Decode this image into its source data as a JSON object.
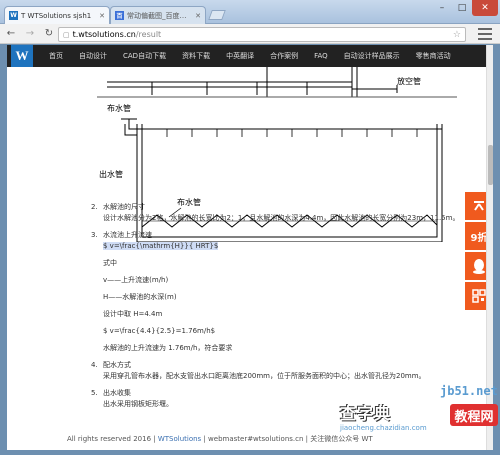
{
  "browser": {
    "tabs": [
      {
        "title": "T WTSolutions sjsh1",
        "favicon": "W",
        "favicon_color": "#1e73be",
        "active": true
      },
      {
        "title": "常动偏截图_百度经验",
        "favicon": "百",
        "favicon_color": "#3a6fd8",
        "active": false
      }
    ],
    "url_host": "t.wtsolutions.cn",
    "url_path": "/result"
  },
  "site": {
    "logo": "W",
    "nav": [
      "首页",
      "自动设计",
      "CAD自动下载",
      "资料下载",
      "中英翻译",
      "合作案例",
      "FAQ",
      "自动设计样品展示",
      "零售商活动"
    ]
  },
  "drawing": {
    "label_distributor_top": "布水管",
    "label_vent": "放空管",
    "label_outlet": "出水管",
    "label_distributor": "布水管"
  },
  "content": {
    "sec2": {
      "num": "2.",
      "heading": "水解池的尺寸",
      "text": "设计水解池分为2格，水解池的长宽比为2：1，且水解池的水深为4.4m，因此水解池的长宽分别为23m，11.5m。"
    },
    "sec3": {
      "num": "3.",
      "heading": "水流池上升流速",
      "formula": "$ v=\\frac{\\mathrm{H}}{ HRT}$",
      "where": "式中",
      "v_def": "v——上升流速(m/h)",
      "h_def": "H——水解池的水深(m)",
      "design": "设计中取 H=4.4m",
      "calc": "$ v=\\frac{4.4}{2.5}=1.76m/h$",
      "result": "水解池的上升流速为 1.76m/h，符合要求"
    },
    "sec4": {
      "num": "4.",
      "heading": "配水方式",
      "text": "采用穿孔管布水器，配水支管出水口距离池底200mm，位于所服务面积的中心；出水管孔径为20mm。"
    },
    "sec5": {
      "num": "5.",
      "heading": "出水收集",
      "text": "出水采用钢板矩形堰。"
    }
  },
  "footer": {
    "copyright": "All rights reserved 2016 |",
    "brand": "WTSolutions",
    "rest": "| webmaster#wtsolutions.cn | 关注微信公众号 WT"
  },
  "sidebuttons": [
    "top",
    "9折",
    "qq",
    "qr"
  ],
  "sidebutton_labels": {
    "discount": "9折"
  },
  "watermark": {
    "url": "jb51.net",
    "main": "查字典",
    "badge": "教程网",
    "sub": "jiaocheng.chazidian.com"
  }
}
